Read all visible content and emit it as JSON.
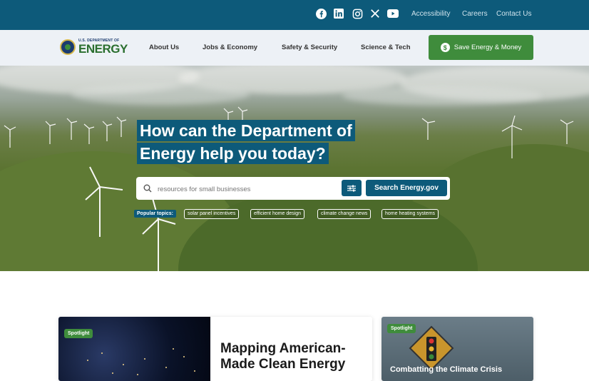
{
  "topbar": {
    "social": [
      "facebook-icon",
      "linkedin-icon",
      "instagram-icon",
      "x-icon",
      "youtube-icon"
    ],
    "links": [
      "Accessibility",
      "Careers",
      "Contact Us"
    ]
  },
  "header": {
    "logo_small": "U.S. DEPARTMENT OF",
    "logo_big": "ENERGY",
    "nav": [
      "About Us",
      "Jobs & Economy",
      "Safety & Security",
      "Science & Tech"
    ],
    "cta_label": "Save Energy & Money",
    "cta_icon": "$"
  },
  "hero": {
    "headline_line1": "How can the Department of",
    "headline_line2": "Energy help you today?",
    "search_placeholder": "resources for small businesses",
    "search_button": "Search Energy.gov",
    "popular_label": "Popular topics:",
    "topics": [
      "solar panel incentives",
      "efficient home design",
      "climate change news",
      "home heating systems"
    ]
  },
  "cards": [
    {
      "badge": "Spotlight",
      "title": "Mapping American-Made Clean Energy"
    },
    {
      "badge": "Spotlight",
      "title": "Combatting the Climate Crisis"
    }
  ],
  "colors": {
    "primary": "#0d5a7a",
    "accent": "#3f8c3c",
    "nav_bg": "#edf1f6"
  }
}
